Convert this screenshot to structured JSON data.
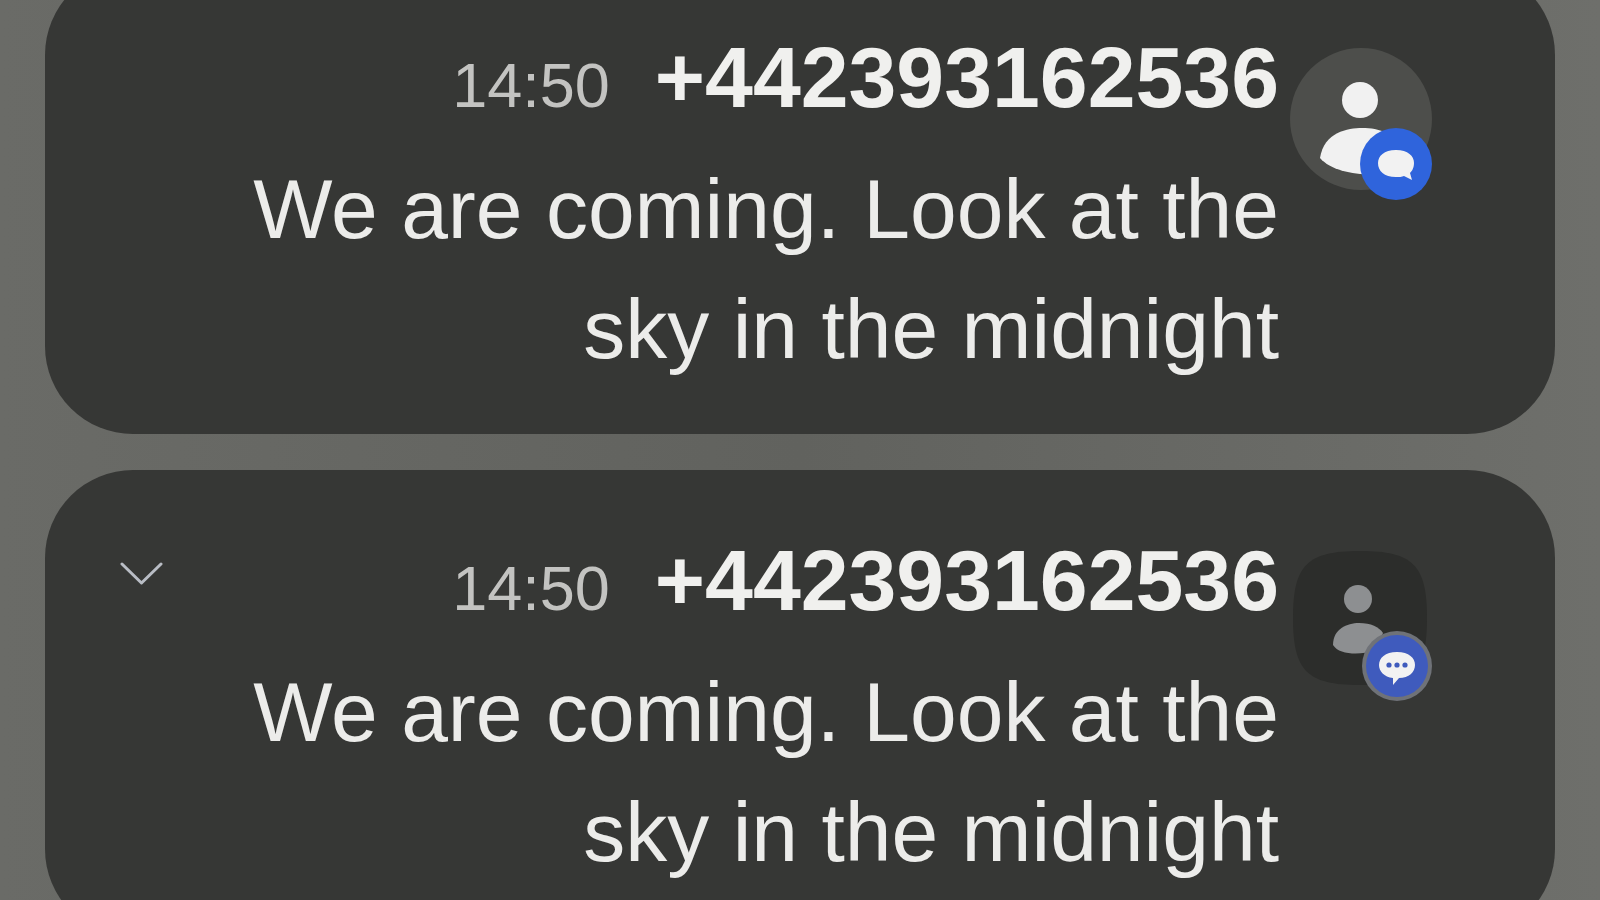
{
  "notifications": [
    {
      "time": "14:50",
      "sender": "+442393162536",
      "message": "We are coming. Look at the sky in the midnight",
      "expand_toggle": false,
      "avatar": {
        "kind": "circle"
      }
    },
    {
      "time": "14:50",
      "sender": "+442393162536",
      "message": "We are coming. Look at the sky in the midnight",
      "expand_toggle": true,
      "avatar": {
        "kind": "squircle"
      }
    }
  ]
}
